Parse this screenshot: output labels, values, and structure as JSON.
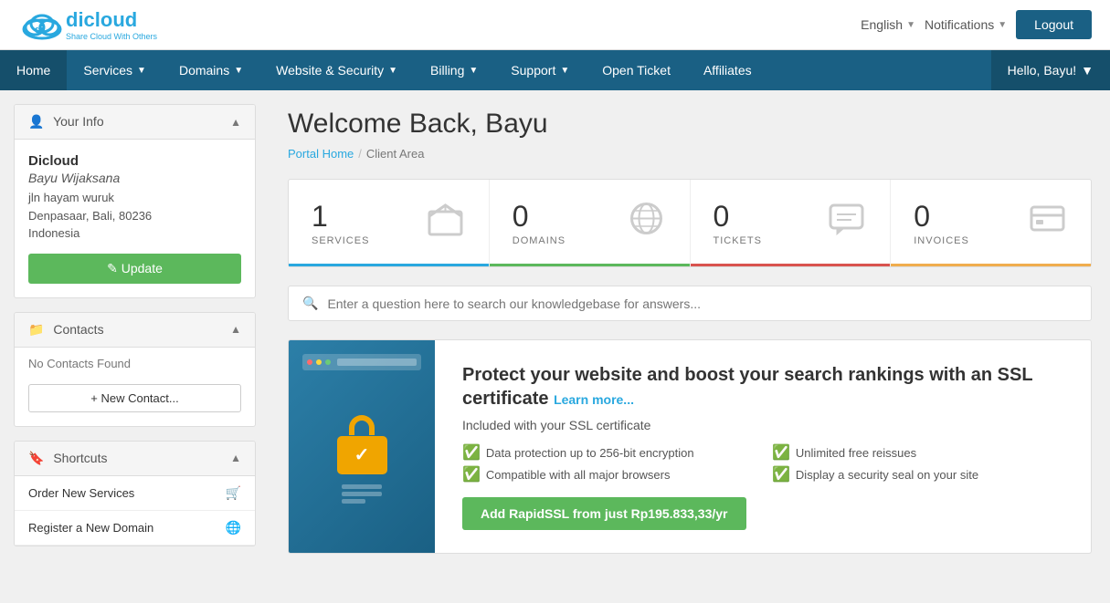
{
  "topbar": {
    "logo_name": "dicloud",
    "logo_tagline": "Share Cloud With Others",
    "language_label": "English",
    "notifications_label": "Notifications",
    "logout_label": "Logout"
  },
  "nav": {
    "items": [
      {
        "label": "Home",
        "has_dropdown": false
      },
      {
        "label": "Services",
        "has_dropdown": true
      },
      {
        "label": "Domains",
        "has_dropdown": true
      },
      {
        "label": "Website & Security",
        "has_dropdown": true
      },
      {
        "label": "Billing",
        "has_dropdown": true
      },
      {
        "label": "Support",
        "has_dropdown": true
      },
      {
        "label": "Open Ticket",
        "has_dropdown": false
      },
      {
        "label": "Affiliates",
        "has_dropdown": false
      }
    ],
    "hello_label": "Hello, Bayu!"
  },
  "sidebar": {
    "your_info": {
      "section_title": "Your Info",
      "company": "Dicloud",
      "name": "Bayu Wijaksana",
      "address_line1": "jln hayam wuruk",
      "address_line2": "Denpasaar, Bali, 80236",
      "address_line3": "Indonesia",
      "update_btn": "✎ Update"
    },
    "contacts": {
      "section_title": "Contacts",
      "no_contacts": "No Contacts Found",
      "new_contact_btn": "+ New Contact..."
    },
    "shortcuts": {
      "section_title": "Shortcuts",
      "items": [
        {
          "label": "Order New Services",
          "icon": "🛒"
        },
        {
          "label": "Register a New Domain",
          "icon": "🌐"
        }
      ]
    }
  },
  "main": {
    "welcome_title": "Welcome Back, Bayu",
    "breadcrumb": {
      "portal_home": "Portal Home",
      "separator": "/",
      "client_area": "Client Area"
    },
    "stats": [
      {
        "num": "1",
        "label": "SERVICES",
        "bar_class": "stat-bar-blue"
      },
      {
        "num": "0",
        "label": "DOMAINS",
        "bar_class": "stat-bar-green"
      },
      {
        "num": "0",
        "label": "TICKETS",
        "bar_class": "stat-bar-red"
      },
      {
        "num": "0",
        "label": "INVOICES",
        "bar_class": "stat-bar-orange"
      }
    ],
    "search_placeholder": "Enter a question here to search our knowledgebase for answers...",
    "ssl": {
      "title": "Protect your website and boost your search rankings with an SSL certificate",
      "learn_more": "Learn more...",
      "included_label": "Included with your SSL certificate",
      "features": [
        "Data protection up to 256-bit encryption",
        "Compatible with all major browsers",
        "Unlimited free reissues",
        "Display a security seal on your site"
      ],
      "cta_label": "Add RapidSSL from just Rp195.833,33/yr"
    }
  }
}
